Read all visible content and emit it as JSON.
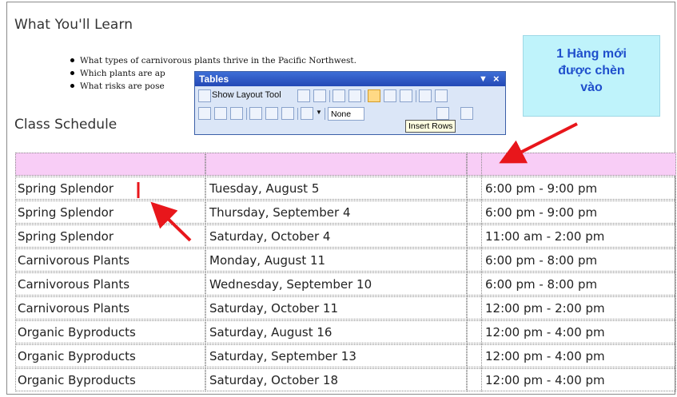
{
  "headings": {
    "learn": "What You'll Learn",
    "class_schedule": "Class Schedule"
  },
  "bullets": [
    "What types of carnivorous plants thrive in the Pacific Northwest.",
    "Which plants are ap",
    "What risks are pose"
  ],
  "toolbar": {
    "title": "Tables",
    "menu_glyph": "▼",
    "close_glyph": "×",
    "show_layout_tool": "Show Layout Tool",
    "style_value": "None",
    "tooltip": "Insert Rows"
  },
  "callout": {
    "text": "1 Hàng mới\nđược chèn\nvào"
  },
  "table": {
    "rows": [
      {
        "class": "Spring Splendor",
        "date": "Tuesday, August 5",
        "time": "6:00 pm - 9:00 pm"
      },
      {
        "class": "Spring Splendor",
        "date": "Thursday, September 4",
        "time": "6:00 pm - 9:00 pm"
      },
      {
        "class": "Spring Splendor",
        "date": "Saturday, October 4",
        "time": "11:00 am - 2:00 pm"
      },
      {
        "class": "Carnivorous Plants",
        "date": "Monday, August 11",
        "time": "6:00 pm - 8:00 pm"
      },
      {
        "class": "Carnivorous Plants",
        "date": "Wednesday, September 10",
        "time": "6:00 pm - 8:00 pm"
      },
      {
        "class": "Carnivorous Plants",
        "date": "Saturday, October 11",
        "time": "12:00 pm - 2:00 pm"
      },
      {
        "class": "Organic Byproducts",
        "date": "Saturday, August 16",
        "time": "12:00 pm - 4:00 pm"
      },
      {
        "class": "Organic Byproducts",
        "date": "Saturday, September 13",
        "time": "12:00 pm - 4:00 pm"
      },
      {
        "class": "Organic Byproducts",
        "date": "Saturday, October 18",
        "time": "12:00 pm - 4:00 pm"
      }
    ]
  },
  "colors": {
    "new_row": "#f8cdf6",
    "callout_bg": "#bff3fb",
    "callout_text": "#1f4fcc",
    "arrow": "#e8161b"
  }
}
